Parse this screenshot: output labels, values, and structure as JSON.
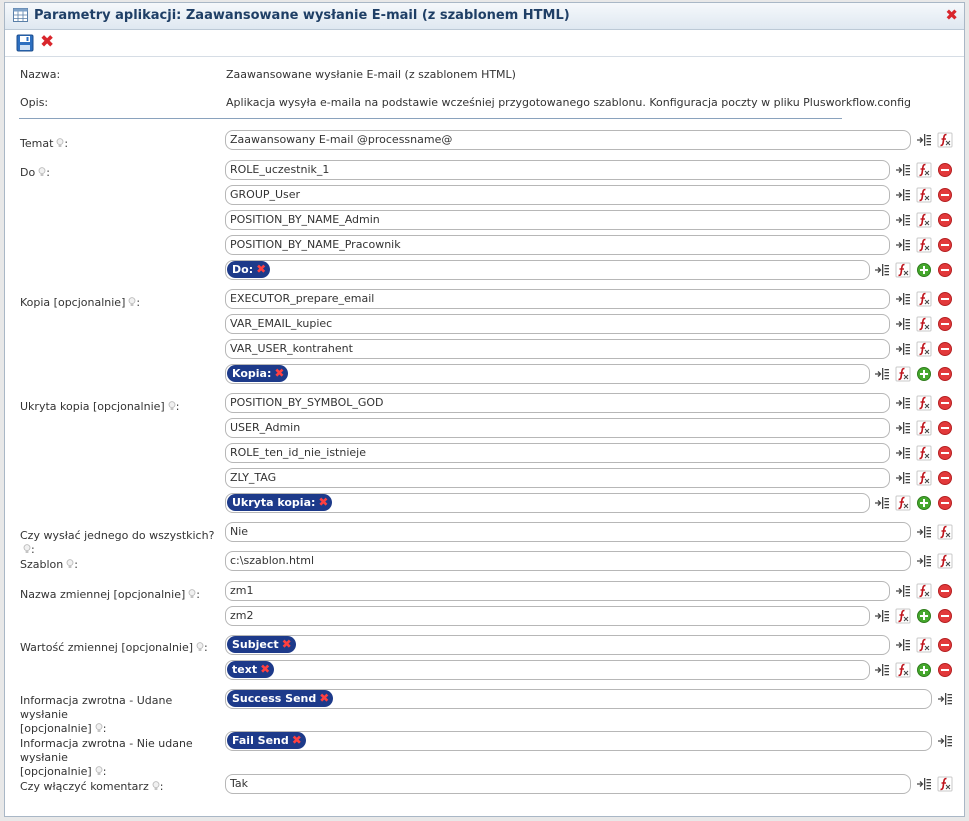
{
  "window": {
    "title": "Parametry aplikacji: Zaawansowane wysłanie E-mail (z szablonem HTML)",
    "close_glyph": "✖"
  },
  "toolbar": {
    "save_icon": "save-icon",
    "cancel_icon": "cancel-icon",
    "cancel_glyph": "✖"
  },
  "info": {
    "name_label": "Nazwa:",
    "name_value": "Zaawansowane wysłanie E-mail (z szablonem HTML)",
    "desc_label": "Opis:",
    "desc_value": "Aplikacja wysyła e-maila na podstawie wcześniej przygotowanego szablonu. Konfiguracja poczty w pliku Plusworkflow.config"
  },
  "fields": {
    "temat": {
      "label": "Temat",
      "value": "Zaawansowany E-mail @processname@"
    },
    "do": {
      "label": "Do",
      "values": [
        "ROLE_uczestnik_1",
        "GROUP_User",
        "POSITION_BY_NAME_Admin",
        "POSITION_BY_NAME_Pracownik"
      ],
      "tag": "Do:"
    },
    "kopia": {
      "label": "Kopia [opcjonalnie]",
      "values": [
        "EXECUTOR_prepare_email",
        "VAR_EMAIL_kupiec",
        "VAR_USER_kontrahent"
      ],
      "tag": "Kopia:"
    },
    "ukryta": {
      "label": "Ukryta kopia [opcjonalnie]",
      "values": [
        "POSITION_BY_SYMBOL_GOD",
        "USER_Admin",
        "ROLE_ten_id_nie_istnieje",
        "ZLY_TAG"
      ],
      "tag": "Ukryta kopia:"
    },
    "czy_jednego": {
      "label": "Czy wysłać jednego do wszystkich?",
      "value": "Nie"
    },
    "szablon": {
      "label": "Szablon",
      "value": "c:\\szablon.html"
    },
    "nazwa_zm": {
      "label": "Nazwa zmiennej [opcjonalnie]",
      "values": [
        "zm1",
        "zm2"
      ]
    },
    "wartosc_zm": {
      "label": "Wartość zmiennej [opcjonalnie]",
      "tags": [
        "Subject",
        "text"
      ]
    },
    "udane": {
      "label_1": "Informacja zwrotna - Udane wysłanie",
      "label_2": "[opcjonalnie]",
      "tag": "Success Send"
    },
    "nieudane": {
      "label_1": "Informacja zwrotna - Nie udane wysłanie",
      "label_2": "[opcjonalnie]",
      "tag": "Fail Send"
    },
    "komentarz": {
      "label": "Czy włączyć komentarz",
      "value": "Tak"
    }
  },
  "colon": ":",
  "tag_remove_glyph": "✖",
  "colors": {
    "tag_bg": "#1d3a8a",
    "remove_red": "#d9262c",
    "add_green": "#3aa02a",
    "separator": "#8aa2bd"
  }
}
